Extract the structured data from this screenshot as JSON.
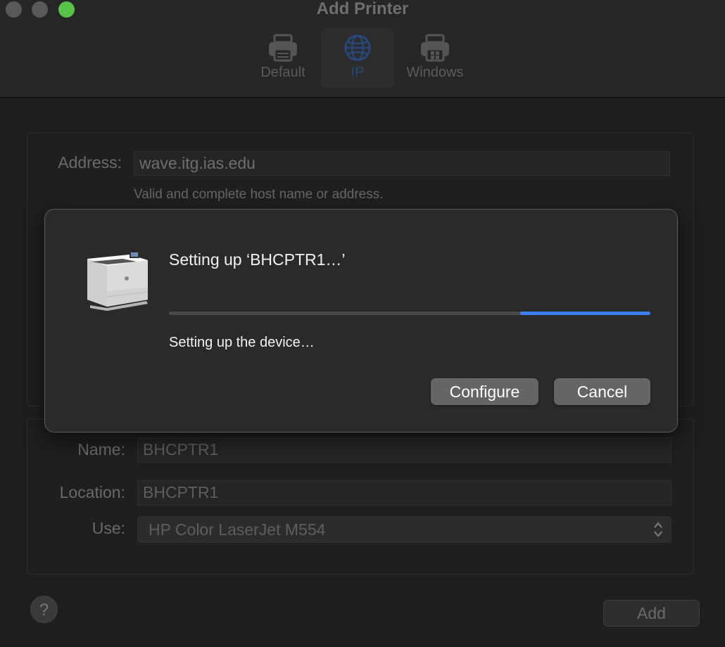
{
  "window": {
    "title": "Add Printer"
  },
  "toolbar": {
    "tabs": [
      {
        "label": "Default",
        "icon": "printer-icon"
      },
      {
        "label": "IP",
        "icon": "globe-icon",
        "selected": true
      },
      {
        "label": "Windows",
        "icon": "windows-printer-icon"
      }
    ]
  },
  "form": {
    "address": {
      "label": "Address:",
      "value": "wave.itg.ias.edu",
      "hint": "Valid and complete host name or address."
    },
    "name": {
      "label": "Name:",
      "value": "BHCPTR1"
    },
    "location": {
      "label": "Location:",
      "value": "BHCPTR1"
    },
    "use": {
      "label": "Use:",
      "value": "HP Color LaserJet M554"
    },
    "help_label": "?",
    "add_label": "Add"
  },
  "sheet": {
    "title": "Setting up ‘BHCPTR1…’",
    "status": "Setting up the device…",
    "progress_start": 0.73,
    "progress_end": 1.0,
    "configure_label": "Configure",
    "cancel_label": "Cancel"
  },
  "colors": {
    "accent": "#3d7ef2",
    "zoom_button": "#58c349"
  }
}
